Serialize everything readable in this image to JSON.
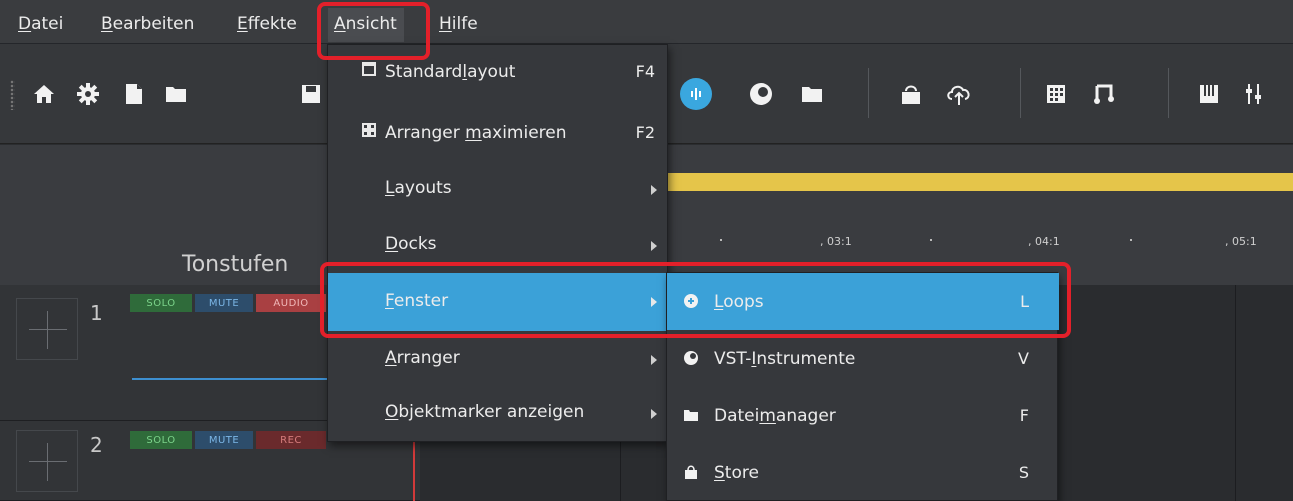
{
  "menubar": {
    "items": [
      {
        "label": "Datei",
        "accel": "D"
      },
      {
        "label": "Bearbeiten",
        "accel": "B"
      },
      {
        "label": "Effekte",
        "accel": "E"
      },
      {
        "label": "Ansicht",
        "accel": "A"
      },
      {
        "label": "Hilfe",
        "accel": "H"
      }
    ]
  },
  "toolbar": {
    "icons": [
      "home-icon",
      "gear-icon",
      "new-file-icon",
      "open-folder-icon",
      "save-icon",
      "loops-icon",
      "vst-instrument-icon",
      "file-manager-icon",
      "store-icon",
      "cloud-icon",
      "grid-icon",
      "music-note-icon",
      "keyboard-icon",
      "mixer-icon"
    ]
  },
  "timeline": {
    "ticks": [
      ", 03:1",
      ", 04:1",
      ", 05:1"
    ],
    "track_header_label": "Tonstufen",
    "loop_color": "#e5c54a"
  },
  "tracks": [
    {
      "number": "1",
      "solo": "SOLO",
      "mute": "MUTE",
      "third": "AUDIO"
    },
    {
      "number": "2",
      "solo": "SOLO",
      "mute": "MUTE",
      "third": "REC"
    }
  ],
  "ansicht_menu": {
    "items": [
      {
        "pre": "Standard",
        "u": "l",
        "post": "ayout",
        "shortcut": "F4",
        "icon": "layout-icon"
      },
      {
        "pre": "Arranger ",
        "u": "m",
        "post": "aximieren",
        "shortcut": "F2",
        "icon": "maximize-icon"
      },
      {
        "pre": "",
        "u": "L",
        "post": "ayouts",
        "submenu": true
      },
      {
        "pre": "",
        "u": "D",
        "post": "ocks",
        "submenu": true
      },
      {
        "pre": "",
        "u": "F",
        "post": "enster",
        "submenu": true,
        "selected": true
      },
      {
        "pre": "",
        "u": "A",
        "post": "rranger",
        "submenu": true
      },
      {
        "pre": "",
        "u": "O",
        "post": "bjektmarker anzeigen",
        "submenu": true
      }
    ]
  },
  "fenster_submenu": {
    "items": [
      {
        "pre": "",
        "u": "L",
        "post": "oops",
        "shortcut": "L",
        "icon": "loops-icon",
        "selected": true
      },
      {
        "pre": "VST-",
        "u": "I",
        "post": "nstrumente",
        "shortcut": "V",
        "icon": "vst-instrument-icon"
      },
      {
        "pre": "Datei",
        "u": "m",
        "post": "anager",
        "shortcut": "F",
        "icon": "folder-icon"
      },
      {
        "pre": "",
        "u": "S",
        "post": "tore",
        "shortcut": "S",
        "icon": "store-icon"
      }
    ]
  },
  "colors": {
    "accent": "#3ba1d8",
    "highlight": "#e3202a",
    "loop_bar": "#e5c54a"
  }
}
